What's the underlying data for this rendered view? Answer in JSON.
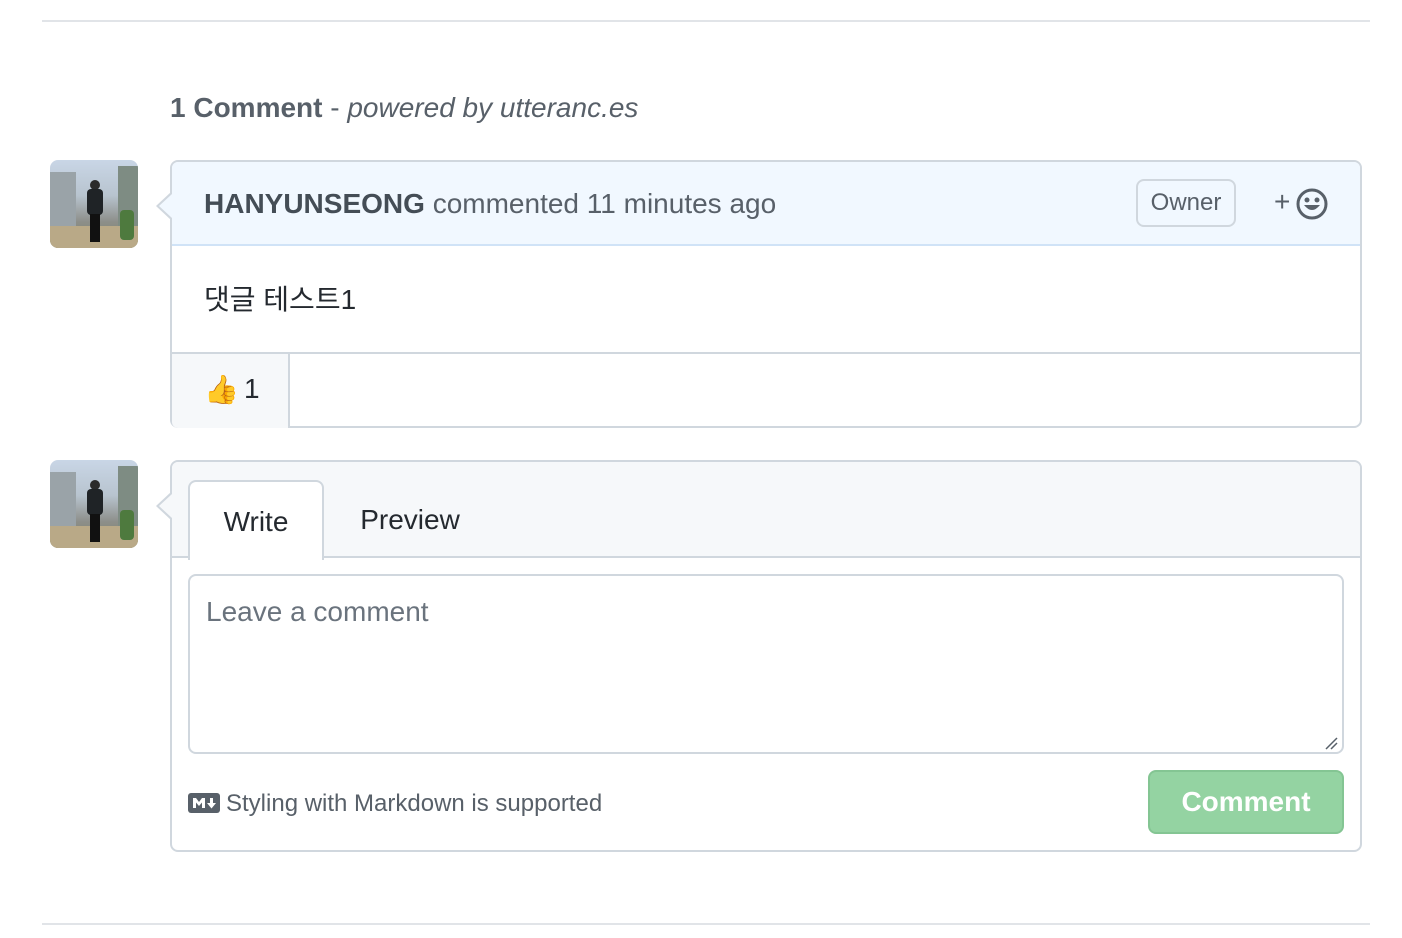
{
  "header": {
    "comment_count": "1 Comment",
    "separator": " - ",
    "powered_by": "powered by utteranc.es"
  },
  "comments": [
    {
      "author": "HANYUNSEONG",
      "action": "commented",
      "time": "11 minutes ago",
      "badge": "Owner",
      "body": "댓글 테스트1",
      "reactions": [
        {
          "emoji": "👍",
          "icon": "thumbs-up-icon",
          "count": "1"
        }
      ]
    }
  ],
  "add_reaction": {
    "plus": "+",
    "icon": "smiley-icon"
  },
  "composer": {
    "tabs": [
      "Write",
      "Preview"
    ],
    "placeholder": "Leave a comment",
    "markdown_note": "Styling with Markdown is supported",
    "markdown_icon": "markdown-icon",
    "submit_label": "Comment",
    "submit_color": "#94d3a2"
  }
}
